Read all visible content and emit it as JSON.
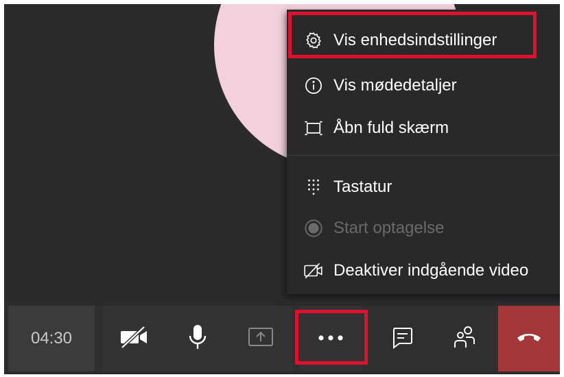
{
  "menu": {
    "items": [
      {
        "label": "Vis enhedsindstillinger",
        "icon": "gear-icon",
        "enabled": true
      },
      {
        "label": "Vis mødedetaljer",
        "icon": "info-icon",
        "enabled": true
      },
      {
        "label": "Åbn fuld skærm",
        "icon": "fullscreen-icon",
        "enabled": true
      },
      {
        "label": "Tastatur",
        "icon": "dialpad-icon",
        "enabled": true
      },
      {
        "label": "Start optagelse",
        "icon": "record-icon",
        "enabled": false
      },
      {
        "label": "Deaktiver indgående video",
        "icon": "video-off-icon",
        "enabled": true
      }
    ]
  },
  "toolbar": {
    "timer": "04:30",
    "buttons": [
      "camera-off-icon",
      "microphone-icon",
      "share-screen-icon",
      "more-options-icon",
      "chat-icon",
      "participants-icon",
      "hang-up-icon"
    ]
  },
  "colors": {
    "highlight": "#e0102e",
    "hangup": "#a4373a",
    "avatar": "#f2d0dc",
    "background": "#2b2b2b"
  }
}
